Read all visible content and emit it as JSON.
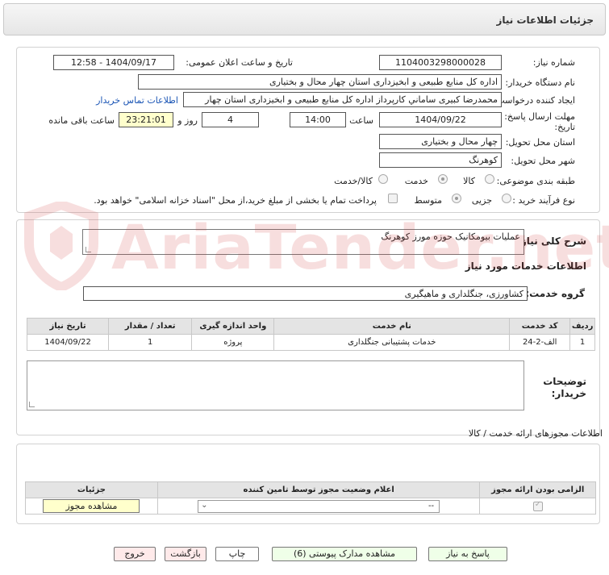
{
  "title": "جزئیات اطلاعات نیاز",
  "form": {
    "need_number_label": "شماره نیاز:",
    "need_number": "1104003298000028",
    "announce_label": "تاریخ و ساعت اعلان عمومی:",
    "announce_value": "1404/09/17 - 12:58",
    "buyer_label": "نام دستگاه خریدار:",
    "buyer_value": "اداره کل منابع طبیعی و ابخیزداری استان چهار محال و بختیاری",
    "creator_label": "ایجاد کننده درخواست:",
    "creator_value": "محمدرضا کبیری ساماني کارپرداز اداره کل منابع طبیعی و ابخیزداری استان چهار",
    "contact_link": "اطلاعات تماس خریدار",
    "deadline_label": "مهلت ارسال پاسخ: تا",
    "deadline_label2": "تاریخ:",
    "deadline_date": "1404/09/22",
    "time_label": "ساعت",
    "deadline_time": "14:00",
    "days_value": "4",
    "days_label": "روز و",
    "remaining_value": "23:21:01",
    "remaining_label": "ساعت باقی مانده",
    "province_label": "استان محل تحویل:",
    "province_value": "چهار محال و بختیاری",
    "city_label": "شهر محل تحویل:",
    "city_value": "کوهرنگ",
    "category_label": "طبقه بندی موضوعی:",
    "category_options": [
      "کالا",
      "خدمت",
      "کالا/خدمت"
    ],
    "category_selected": "خدمت",
    "process_label": "نوع فرآیند خرید :",
    "process_options": [
      "جزیی",
      "متوسط"
    ],
    "process_selected": "متوسط",
    "payment_text": "پرداخت تمام یا بخشی از مبلغ خرید،از محل \"اسناد خزانه اسلامی\" خواهد بود."
  },
  "description": {
    "label": "شرح کلی نیاز:",
    "value": "عملیات بیومکانیک حوزه مورز کوهرنگ",
    "services_heading": "اطلاعات خدمات مورد نیاز",
    "group_label": "گروه خدمت:",
    "group_value": "کشاورزی، جنگلداری و ماهیگیری"
  },
  "services_table": {
    "headers": [
      "ردیف",
      "کد خدمت",
      "نام خدمت",
      "واحد اندازه گیری",
      "تعداد / مقدار",
      "تاریخ نیاز"
    ],
    "rows": [
      [
        "1",
        "الف-2-24",
        "خدمات پشتیبانی جنگلداری",
        "پروژه",
        "1",
        "1404/09/22"
      ]
    ]
  },
  "buyer_notes": {
    "label_line1": "توضیحات",
    "label_line2": "خریدار:",
    "value": ""
  },
  "permits": {
    "heading": "اطلاعات مجوزهای ارائه خدمت / کالا",
    "headers": [
      "الزامی بودن ارائه مجوز",
      "اعلام وضعیت مجوز توسط تامین کننده",
      "جزئیات"
    ],
    "select_value": "--",
    "view_button": "مشاهده مجوز"
  },
  "buttons": {
    "reply": "پاسخ به نیاز",
    "attachments": "مشاهده مدارک پیوستی (6)",
    "print": "چاپ",
    "back": "بازگشت",
    "exit": "خروج"
  },
  "watermark": "AriaTender.net",
  "colors": {
    "link": "#1a55b5",
    "highlight": "#ffffcc",
    "watermark": "#d23b3b"
  }
}
